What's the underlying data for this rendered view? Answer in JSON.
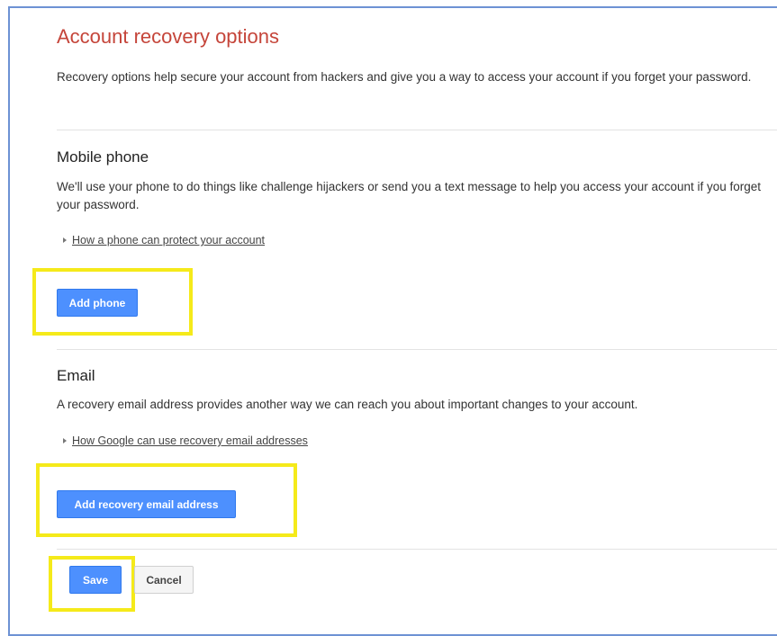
{
  "page": {
    "title": "Account recovery options",
    "intro": "Recovery options help secure your account from hackers and give you a way to access your account if you forget your password."
  },
  "phone_section": {
    "heading": "Mobile phone",
    "description": "We'll use your phone to do things like challenge hijackers or send you a text message to help you access your account if you forget your password.",
    "help_link": "How a phone can protect your account",
    "button_label": "Add phone"
  },
  "email_section": {
    "heading": "Email",
    "description": "A recovery email address provides another way we can reach you about important changes to your account.",
    "help_link": "How Google can use recovery email addresses",
    "button_label": "Add recovery email address"
  },
  "actions": {
    "save_label": "Save",
    "cancel_label": "Cancel"
  },
  "colors": {
    "title": "#c5453a",
    "primary_button": "#4d90fe",
    "highlight": "#f5ea1a",
    "frame_border": "#6d92d4"
  }
}
